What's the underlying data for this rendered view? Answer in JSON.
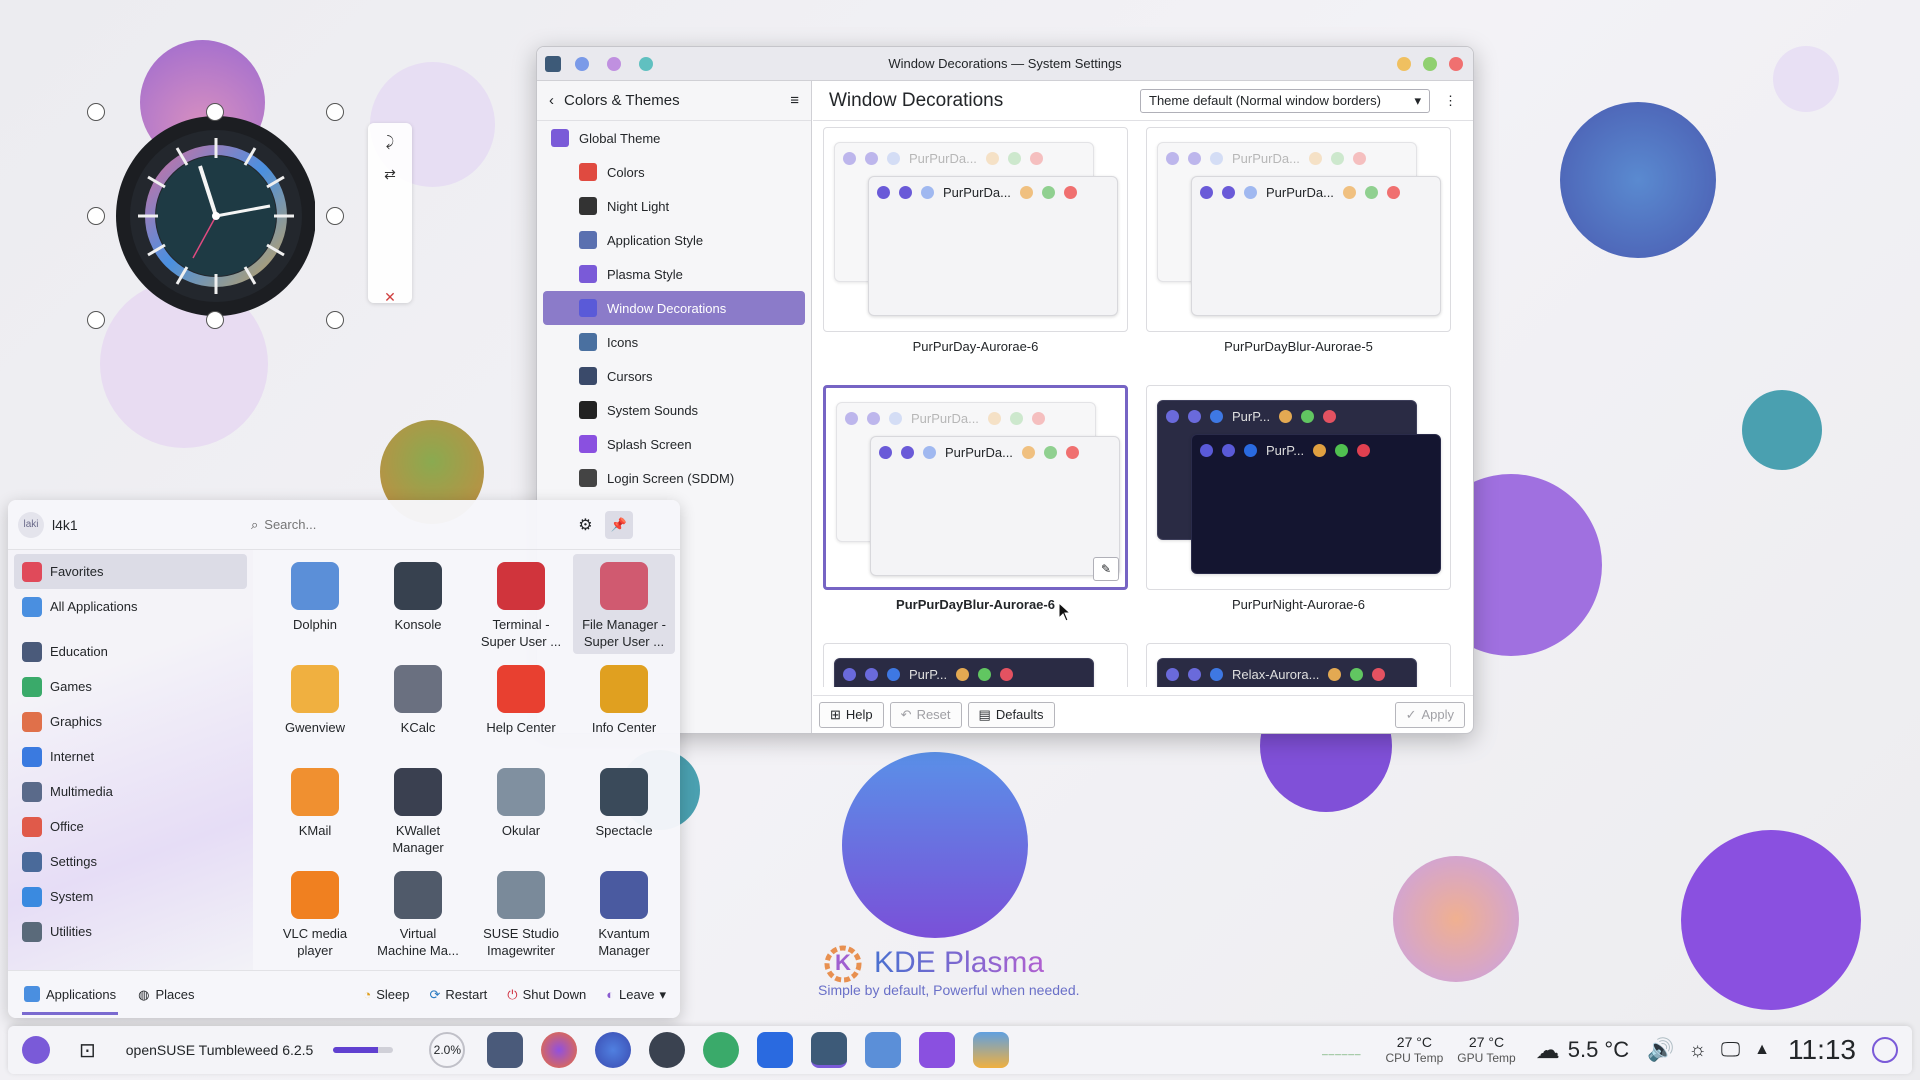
{
  "window": {
    "title": "Window Decorations — System Settings",
    "sidebar_header": "Colors & Themes",
    "sidebar_items": [
      {
        "label": "Global Theme",
        "icon": "global-theme-icon",
        "sub": false
      },
      {
        "label": "Colors",
        "icon": "colors-icon",
        "sub": true
      },
      {
        "label": "Night Light",
        "icon": "night-light-icon",
        "sub": true
      },
      {
        "label": "Application Style",
        "icon": "app-style-icon",
        "sub": true
      },
      {
        "label": "Plasma Style",
        "icon": "plasma-style-icon",
        "sub": true
      },
      {
        "label": "Window Decorations",
        "icon": "window-decorations-icon",
        "sub": true,
        "active": true
      },
      {
        "label": "Icons",
        "icon": "icons-icon",
        "sub": true
      },
      {
        "label": "Cursors",
        "icon": "cursors-icon",
        "sub": true
      },
      {
        "label": "System Sounds",
        "icon": "sounds-icon",
        "sub": true
      },
      {
        "label": "Splash Screen",
        "icon": "splash-icon",
        "sub": true
      },
      {
        "label": "Login Screen (SDDM)",
        "icon": "login-icon",
        "sub": true
      }
    ],
    "page_title": "Window Decorations",
    "border_select": "Theme default (Normal window borders)",
    "themes": [
      {
        "name": "PurPurDay-Aurorae-6",
        "preview": "PurPurDa...",
        "dark": false
      },
      {
        "name": "PurPurDayBlur-Aurorae-5",
        "preview": "PurPurDa...",
        "dark": false
      },
      {
        "name": "PurPurDayBlur-Aurorae-6",
        "preview": "PurPurDa...",
        "dark": false,
        "selected": true
      },
      {
        "name": "PurPurNight-Aurorae-6",
        "preview": "PurP...",
        "dark": true
      },
      {
        "name": "",
        "preview": "PurP...",
        "dark": true
      },
      {
        "name": "",
        "preview": "Relax-Aurora...",
        "dark": true
      }
    ],
    "buttons": {
      "help": "Help",
      "reset": "Reset",
      "defaults": "Defaults",
      "apply": "Apply"
    }
  },
  "launcher": {
    "user": "l4k1",
    "avatar_text": "laki",
    "search_placeholder": "Search...",
    "categories": [
      {
        "label": "Favorites",
        "color": "#e04a5a"
      },
      {
        "label": "All Applications",
        "color": "#4a8fe0"
      },
      {
        "label": "Education",
        "color": "#4a5a7a"
      },
      {
        "label": "Games",
        "color": "#3aaa6a"
      },
      {
        "label": "Graphics",
        "color": "#e0704a"
      },
      {
        "label": "Internet",
        "color": "#3a7ae0"
      },
      {
        "label": "Multimedia",
        "color": "#5a6a8a"
      },
      {
        "label": "Office",
        "color": "#e05a4a"
      },
      {
        "label": "Settings",
        "color": "#4a6a9a"
      },
      {
        "label": "System",
        "color": "#3a8ae0"
      },
      {
        "label": "Utilities",
        "color": "#5a6a7a"
      }
    ],
    "apps": [
      {
        "label": "Dolphin",
        "color": "#5b8fd8"
      },
      {
        "label": "Konsole",
        "color": "#37414f"
      },
      {
        "label": "Terminal -\nSuper User ...",
        "color": "#d0343c"
      },
      {
        "label": "File Manager -\nSuper User ...",
        "color": "#d05a70"
      },
      {
        "label": "Gwenview",
        "color": "#f0b040"
      },
      {
        "label": "KCalc",
        "color": "#6a7080"
      },
      {
        "label": "Help Center",
        "color": "#e84030"
      },
      {
        "label": "Info Center",
        "color": "#e0a020"
      },
      {
        "label": "KMail",
        "color": "#f09030"
      },
      {
        "label": "KWallet\nManager",
        "color": "#3a4050"
      },
      {
        "label": "Okular",
        "color": "#8090a0"
      },
      {
        "label": "Spectacle",
        "color": "#3a4a5a"
      },
      {
        "label": "VLC media\nplayer",
        "color": "#f08020"
      },
      {
        "label": "Virtual\nMachine Ma...",
        "color": "#505a6a"
      },
      {
        "label": "SUSE Studio\nImagewriter",
        "color": "#7a8a9a"
      },
      {
        "label": "Kvantum\nManager",
        "color": "#4a5aa0"
      }
    ],
    "footer": {
      "applications": "Applications",
      "places": "Places",
      "sleep": "Sleep",
      "restart": "Restart",
      "shutdown": "Shut Down",
      "leave": "Leave"
    }
  },
  "taskbar": {
    "os_label": "openSUSE Tumbleweed 6.2.5",
    "os_progress": 0.75,
    "cpu_load": "2.0%",
    "cpu_temp": "27 °C",
    "cpu_temp_label": "CPU Temp",
    "gpu_temp": "27 °C",
    "gpu_temp_label": "GPU Temp",
    "weather": "5.5 °C",
    "time": "11:13"
  },
  "desktop": {
    "kde_title": "KDE Plasma",
    "kde_slogan": "Simple by default, Powerful when needed."
  }
}
